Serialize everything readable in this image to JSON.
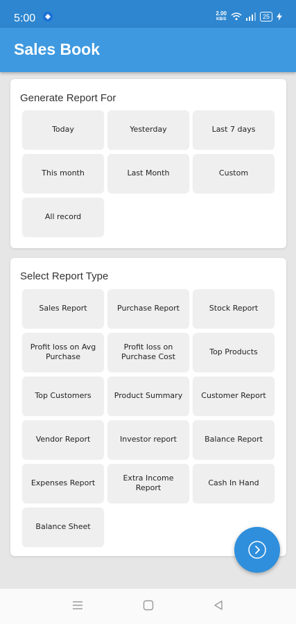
{
  "status": {
    "time": "5:00",
    "net_speed_value": "2.00",
    "net_speed_unit": "KB/S",
    "battery": "25"
  },
  "app": {
    "title": "Sales Book"
  },
  "period_section": {
    "title": "Generate Report For",
    "options": [
      "Today",
      "Yesterday",
      "Last 7 days",
      "This month",
      "Last Month",
      "Custom",
      "All record"
    ]
  },
  "report_section": {
    "title": "Select Report Type",
    "options": [
      "Sales Report",
      "Purchase Report",
      "Stock Report",
      "Profit loss on Avg Purchase",
      "Profit loss on Purchase Cost",
      "Top Products",
      "Top Customers",
      "Product Summary",
      "Customer Report",
      "Vendor Report",
      "Investor report",
      "Balance Report",
      "Expenses Report",
      "Extra Income Report",
      "Cash In Hand",
      "Balance Sheet"
    ]
  },
  "icons": {
    "fab": "chevron-right-icon",
    "nav": [
      "menu-icon",
      "home-square-icon",
      "back-triangle-icon"
    ]
  },
  "colors": {
    "status_bar": "#2d86cf",
    "app_bar": "#3e99e0",
    "fab": "#2f8fdc",
    "background": "#e6e6e6"
  }
}
